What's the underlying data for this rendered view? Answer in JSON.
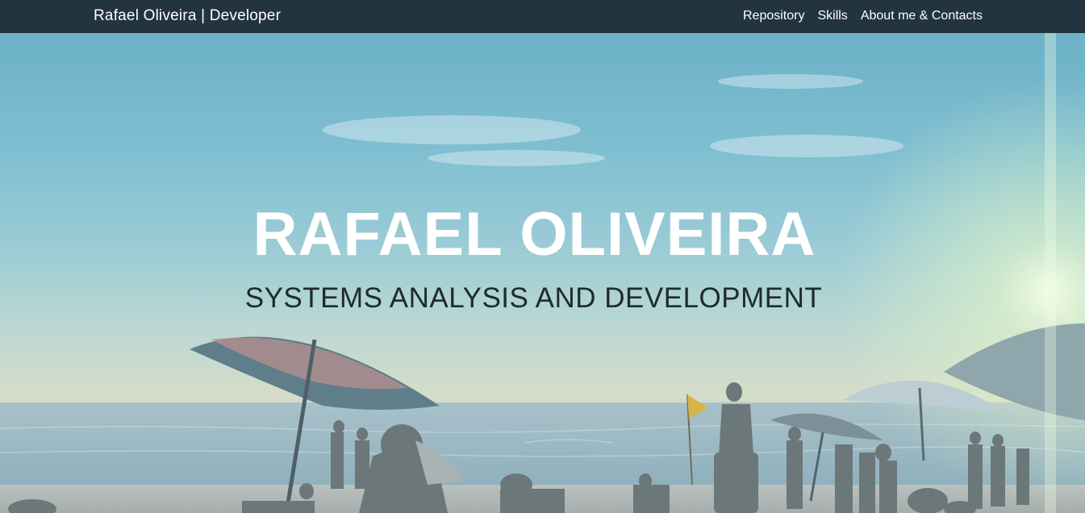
{
  "navbar": {
    "brand": "Rafael Oliveira | Developer",
    "links": [
      "Repository",
      "Skills",
      "About me & Contacts"
    ]
  },
  "hero": {
    "title": "RAFAEL OLIVEIRA",
    "subtitle": "SYSTEMS ANALYSIS AND DEVELOPMENT",
    "background": "beach-photo"
  },
  "colors": {
    "navbar_bg": "#22343d",
    "nav_text": "#ffffff",
    "title_text": "#ffffff",
    "subtitle_text": "#1f2a2e"
  }
}
